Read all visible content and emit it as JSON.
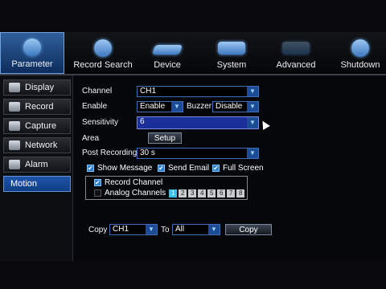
{
  "nav": {
    "tabs": [
      {
        "label": "Parameter",
        "icon": "gear-icon",
        "active": true
      },
      {
        "label": "Record Search",
        "icon": "search-icon",
        "active": false
      },
      {
        "label": "Device",
        "icon": "hard-drive-icon",
        "active": false
      },
      {
        "label": "System",
        "icon": "monitor-icon",
        "active": false
      },
      {
        "label": "Advanced",
        "icon": "wrench-icon",
        "active": false
      },
      {
        "label": "Shutdown",
        "icon": "power-icon",
        "active": false
      }
    ]
  },
  "sidebar": {
    "items": [
      {
        "label": "Display",
        "icon": "display-icon"
      },
      {
        "label": "Record",
        "icon": "record-icon"
      },
      {
        "label": "Capture",
        "icon": "camera-icon"
      },
      {
        "label": "Network",
        "icon": "network-icon"
      },
      {
        "label": "Alarm",
        "icon": "alarm-icon"
      },
      {
        "label": "Motion",
        "icon": "",
        "active": true
      }
    ]
  },
  "form": {
    "channel_label": "Channel",
    "channel_value": "CH1",
    "enable_label": "Enable",
    "enable_value": "Enable",
    "buzzer_label": "Buzzer",
    "buzzer_value": "Disable",
    "sensitivity_label": "Sensitivity",
    "sensitivity_value": "6",
    "area_label": "Area",
    "setup_label": "Setup",
    "post_recording_label": "Post Recording",
    "post_recording_value": "30 s",
    "show_message_label": "Show Message",
    "show_message_checked": true,
    "send_email_label": "Send Email",
    "send_email_checked": true,
    "full_screen_label": "Full Screen",
    "full_screen_checked": true,
    "record_channel_label": "Record Channel",
    "record_channel_checked": true,
    "analog_channels_label": "Analog Channels",
    "analog_channels_checked": false,
    "channels": [
      "1",
      "2",
      "3",
      "4",
      "5",
      "6",
      "7",
      "8"
    ],
    "selected_channel": "1",
    "copy_label": "Copy",
    "copy_from_value": "CH1",
    "to_label": "To",
    "copy_to_value": "All",
    "copy_button_label": "Copy"
  },
  "colors": {
    "accent": "#1b4c95",
    "active_tab": "#2f5f9a",
    "highlight": "#1b2f9a",
    "channel_on": "#3cc0e8"
  }
}
